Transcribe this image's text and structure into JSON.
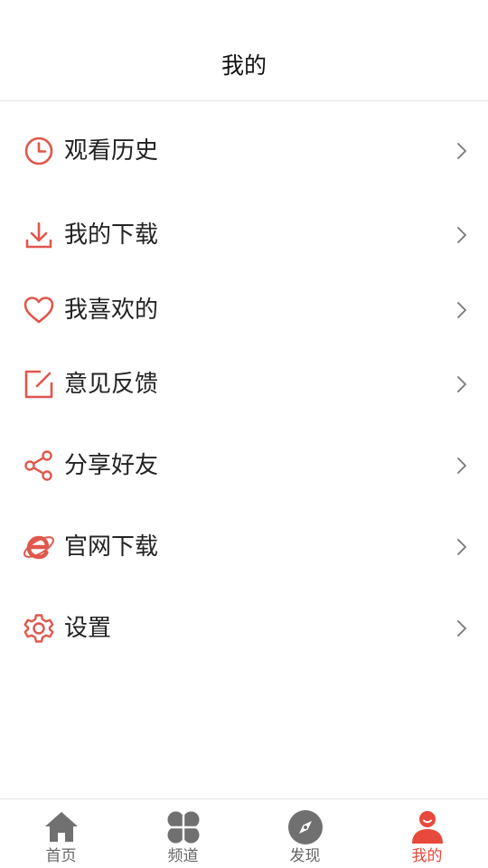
{
  "header": {
    "title": "我的"
  },
  "accent_color": "#e8493c",
  "icon_color": "#e0574b",
  "inactive_tab_color": "#707070",
  "menu": {
    "items": [
      {
        "label": "观看历史",
        "icon": "clock-icon"
      },
      {
        "label": "我的下载",
        "icon": "download-icon"
      },
      {
        "label": "我喜欢的",
        "icon": "heart-icon"
      },
      {
        "label": "意见反馈",
        "icon": "feedback-edit-icon"
      },
      {
        "label": "分享好友",
        "icon": "share-icon"
      },
      {
        "label": "官网下载",
        "icon": "ie-browser-icon"
      },
      {
        "label": "设置",
        "icon": "gear-icon"
      }
    ]
  },
  "tabbar": {
    "items": [
      {
        "label": "首页",
        "icon": "home-icon",
        "active": false
      },
      {
        "label": "频道",
        "icon": "four-petal-icon",
        "active": false
      },
      {
        "label": "发现",
        "icon": "compass-icon",
        "active": false
      },
      {
        "label": "我的",
        "icon": "user-icon",
        "active": true
      }
    ]
  }
}
